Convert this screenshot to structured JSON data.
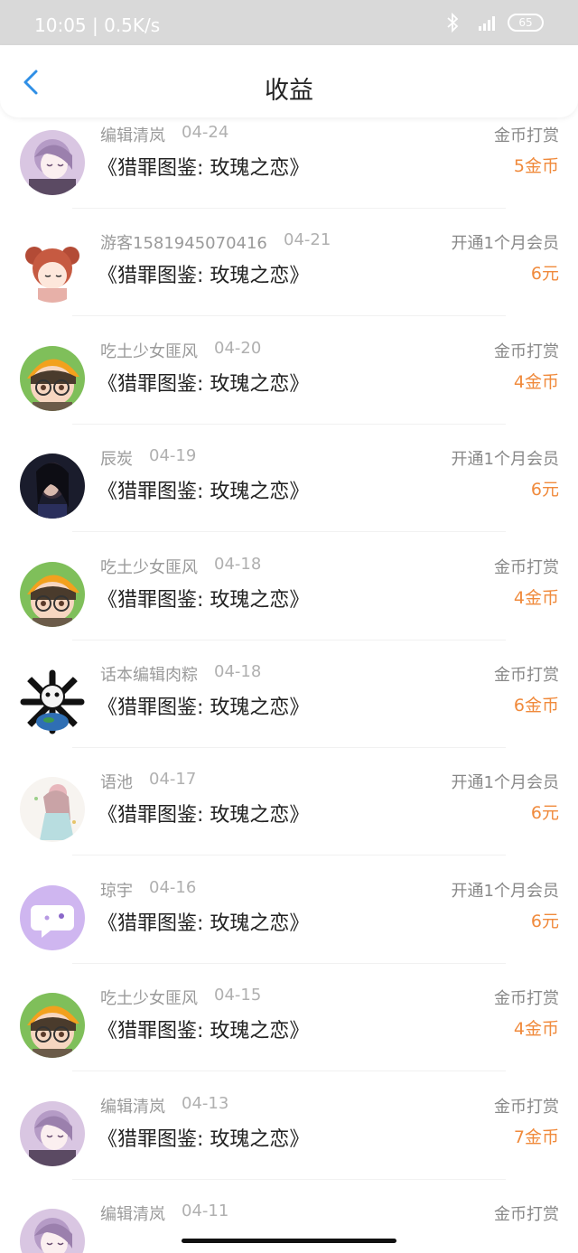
{
  "status_bar": {
    "time": "10:05",
    "net_speed": "0.5K/s",
    "battery": "65",
    "signal_label": "4G"
  },
  "header": {
    "title": "收益"
  },
  "records": [
    {
      "name": "编辑清岚",
      "date": "04-24",
      "book": "《猎罪图鉴: 玫瑰之恋》",
      "type": "金币打赏",
      "amount": "5金币",
      "avatar": "anime-girl-purple"
    },
    {
      "name": "游客1581945070416",
      "date": "04-21",
      "book": "《猎罪图鉴: 玫瑰之恋》",
      "type": "开通1个月会员",
      "amount": "6元",
      "avatar": "bear-ears-girl"
    },
    {
      "name": "吃土少女匪风",
      "date": "04-20",
      "book": "《猎罪图鉴: 玫瑰之恋》",
      "type": "金币打赏",
      "amount": "4金币",
      "avatar": "glasses-boy"
    },
    {
      "name": "辰炭",
      "date": "04-19",
      "book": "《猎罪图鉴: 玫瑰之恋》",
      "type": "开通1个月会员",
      "amount": "6元",
      "avatar": "dark-photo"
    },
    {
      "name": "吃土少女匪风",
      "date": "04-18",
      "book": "《猎罪图鉴: 玫瑰之恋》",
      "type": "金币打赏",
      "amount": "4金币",
      "avatar": "glasses-boy"
    },
    {
      "name": "话本编辑肉粽",
      "date": "04-18",
      "book": "《猎罪图鉴: 玫瑰之恋》",
      "type": "金币打赏",
      "amount": "6金币",
      "avatar": "skull-earth"
    },
    {
      "name": "语池",
      "date": "04-17",
      "book": "《猎罪图鉴: 玫瑰之恋》",
      "type": "开通1个月会员",
      "amount": "6元",
      "avatar": "pastel-girl"
    },
    {
      "name": "琼宇",
      "date": "04-16",
      "book": "《猎罪图鉴: 玫瑰之恋》",
      "type": "开通1个月会员",
      "amount": "6元",
      "avatar": "chat-bubble"
    },
    {
      "name": "吃土少女匪风",
      "date": "04-15",
      "book": "《猎罪图鉴: 玫瑰之恋》",
      "type": "金币打赏",
      "amount": "4金币",
      "avatar": "glasses-boy"
    },
    {
      "name": "编辑清岚",
      "date": "04-13",
      "book": "《猎罪图鉴: 玫瑰之恋》",
      "type": "金币打赏",
      "amount": "7金币",
      "avatar": "anime-girl-purple"
    },
    {
      "name": "编辑清岚",
      "date": "04-11",
      "book": "",
      "type": "金币打赏",
      "amount": "",
      "avatar": "anime-girl-purple"
    }
  ]
}
